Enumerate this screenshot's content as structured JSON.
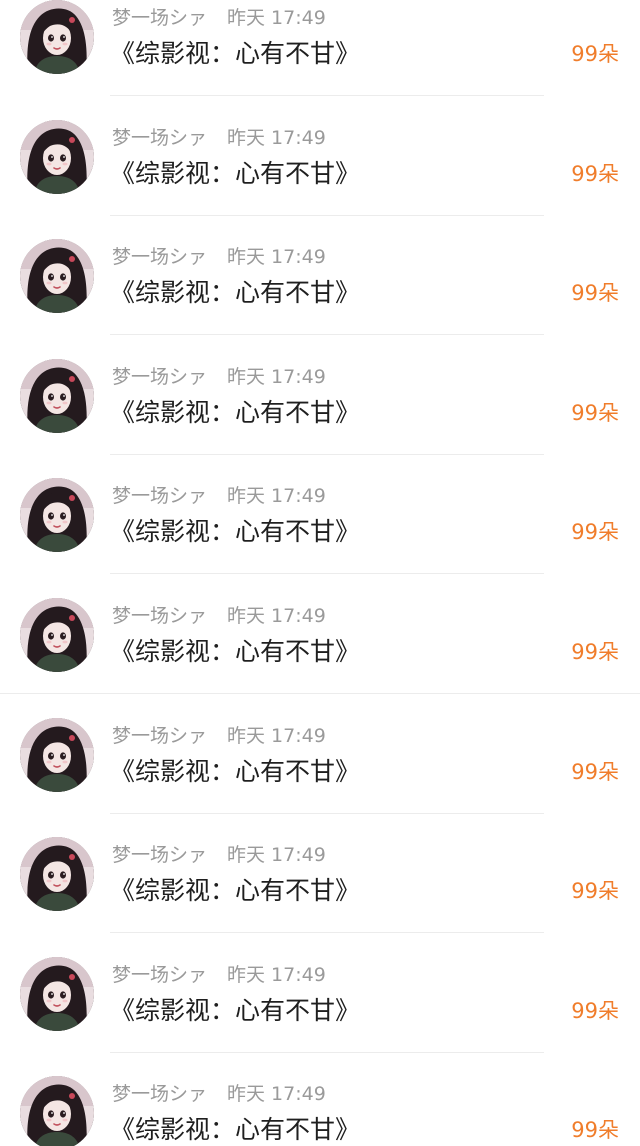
{
  "items": [
    {
      "username": "梦一场シァ",
      "time": "昨天 17:49",
      "title": "《综影视：心有不甘》",
      "flowers": "99朵"
    },
    {
      "username": "梦一场シァ",
      "time": "昨天 17:49",
      "title": "《综影视：心有不甘》",
      "flowers": "99朵"
    },
    {
      "username": "梦一场シァ",
      "time": "昨天 17:49",
      "title": "《综影视：心有不甘》",
      "flowers": "99朵"
    },
    {
      "username": "梦一场シァ",
      "time": "昨天 17:49",
      "title": "《综影视：心有不甘》",
      "flowers": "99朵"
    },
    {
      "username": "梦一场シァ",
      "time": "昨天 17:49",
      "title": "《综影视：心有不甘》",
      "flowers": "99朵"
    },
    {
      "username": "梦一场シァ",
      "time": "昨天 17:49",
      "title": "《综影视：心有不甘》",
      "flowers": "99朵"
    },
    {
      "username": "梦一场シァ",
      "time": "昨天 17:49",
      "title": "《综影视：心有不甘》",
      "flowers": "99朵"
    },
    {
      "username": "梦一场シァ",
      "time": "昨天 17:49",
      "title": "《综影视：心有不甘》",
      "flowers": "99朵"
    },
    {
      "username": "梦一场シァ",
      "time": "昨天 17:49",
      "title": "《综影视：心有不甘》",
      "flowers": "99朵"
    },
    {
      "username": "梦一场シァ",
      "time": "昨天 17:49",
      "title": "《综影视：心有不甘》",
      "flowers": "99朵"
    }
  ],
  "colors": {
    "meta": "#9a9a9a",
    "title": "#1f1f1f",
    "flowers": "#f07d2b"
  }
}
